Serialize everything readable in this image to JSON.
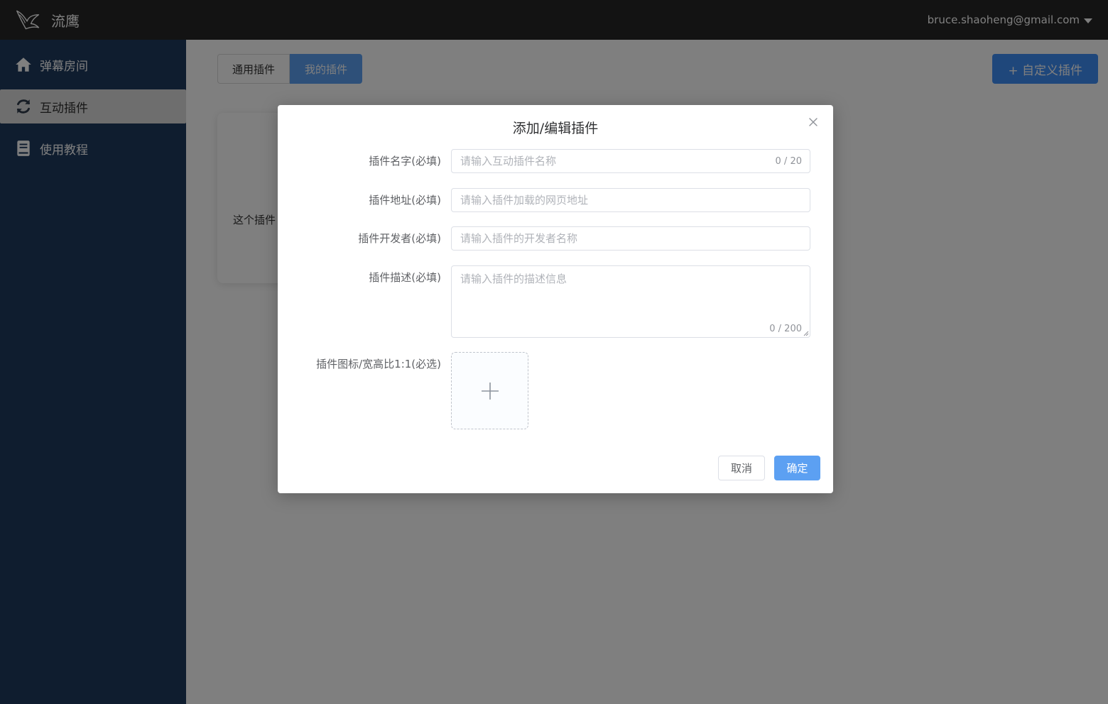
{
  "app": {
    "name": "流鹰",
    "user_email": "bruce.shaoheng@gmail.com"
  },
  "sidebar": {
    "items": [
      {
        "label": "弹幕房间",
        "icon": "home-icon"
      },
      {
        "label": "互动插件",
        "icon": "refresh-icon",
        "active": true
      },
      {
        "label": "使用教程",
        "icon": "book-icon"
      }
    ]
  },
  "main": {
    "tabs": [
      {
        "label": "通用插件"
      },
      {
        "label": "我的插件",
        "active": true
      }
    ],
    "custom_button": "+ 自定义插件",
    "card_text": "这个插件"
  },
  "modal": {
    "title": "添加/编辑插件",
    "fields": {
      "name": {
        "label": "插件名字(必填)",
        "placeholder": "请输入互动插件名称",
        "counter": "0 / 20"
      },
      "url": {
        "label": "插件地址(必填)",
        "placeholder": "请输入插件加载的网页地址"
      },
      "developer": {
        "label": "插件开发者(必填)",
        "placeholder": "请输入插件的开发者名称"
      },
      "description": {
        "label": "插件描述(必填)",
        "placeholder": "请输入插件的描述信息",
        "counter": "0 / 200"
      },
      "icon": {
        "label": "插件图标/宽高比1:1(必选)"
      }
    },
    "cancel_label": "取消",
    "confirm_label": "确定"
  },
  "colors": {
    "topbar": "#262626",
    "sidebar": "#1f3a5f",
    "primary": "#3e8ef7",
    "primary_light": "#5ca0f2"
  }
}
